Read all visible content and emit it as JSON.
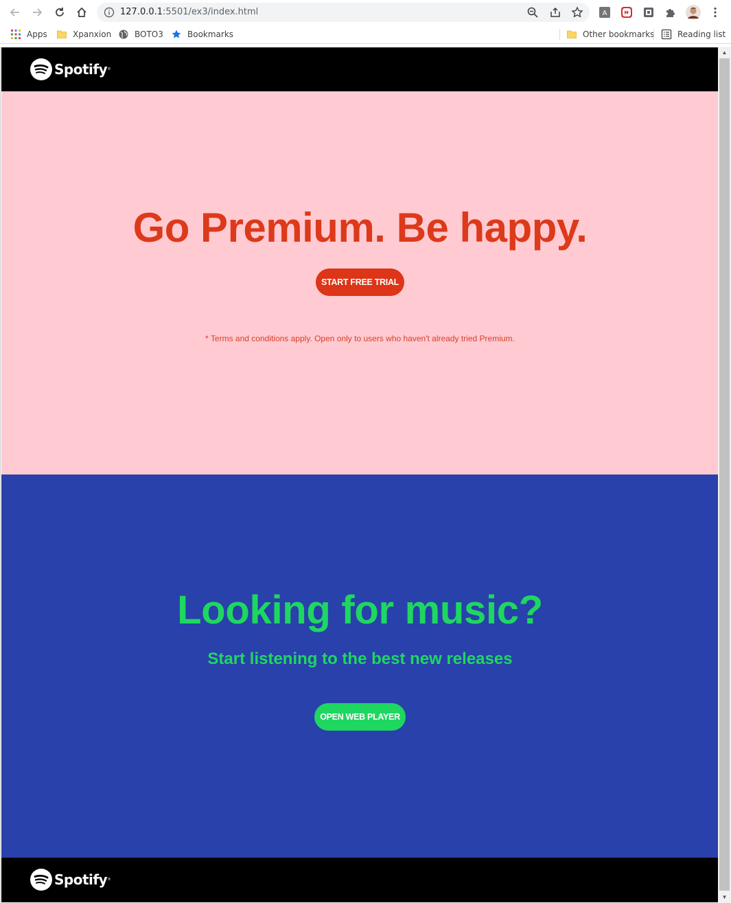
{
  "browser": {
    "url_host": "127.0.0.1",
    "url_rest": ":5501/ex3/index.html",
    "bookmarks": [
      {
        "label": "Apps",
        "icon": "apps-grid-icon"
      },
      {
        "label": "Xpanxion",
        "icon": "folder-icon"
      },
      {
        "label": "BOTO3",
        "icon": "globe-icon"
      },
      {
        "label": "Bookmarks",
        "icon": "star-icon"
      }
    ],
    "other_bookmarks": "Other bookmarks",
    "reading_list": "Reading list"
  },
  "header": {
    "logo_text": "Spotify"
  },
  "premium": {
    "title": "Go Premium. Be happy.",
    "cta_label": "START FREE TRIAL",
    "terms": "* Terms and conditions apply. Open only to users who haven't already tried Premium."
  },
  "music": {
    "title": "Looking for music?",
    "subtitle": "Start listening to the best new releases",
    "cta_label": "OPEN WEB PLAYER"
  },
  "footer": {
    "logo_text": "Spotify"
  },
  "colors": {
    "premium_bg": "#ffcad1",
    "premium_accent": "#dc3a1a",
    "music_bg": "#2941ab",
    "music_accent": "#1ed760",
    "bar_bg": "#000000"
  }
}
